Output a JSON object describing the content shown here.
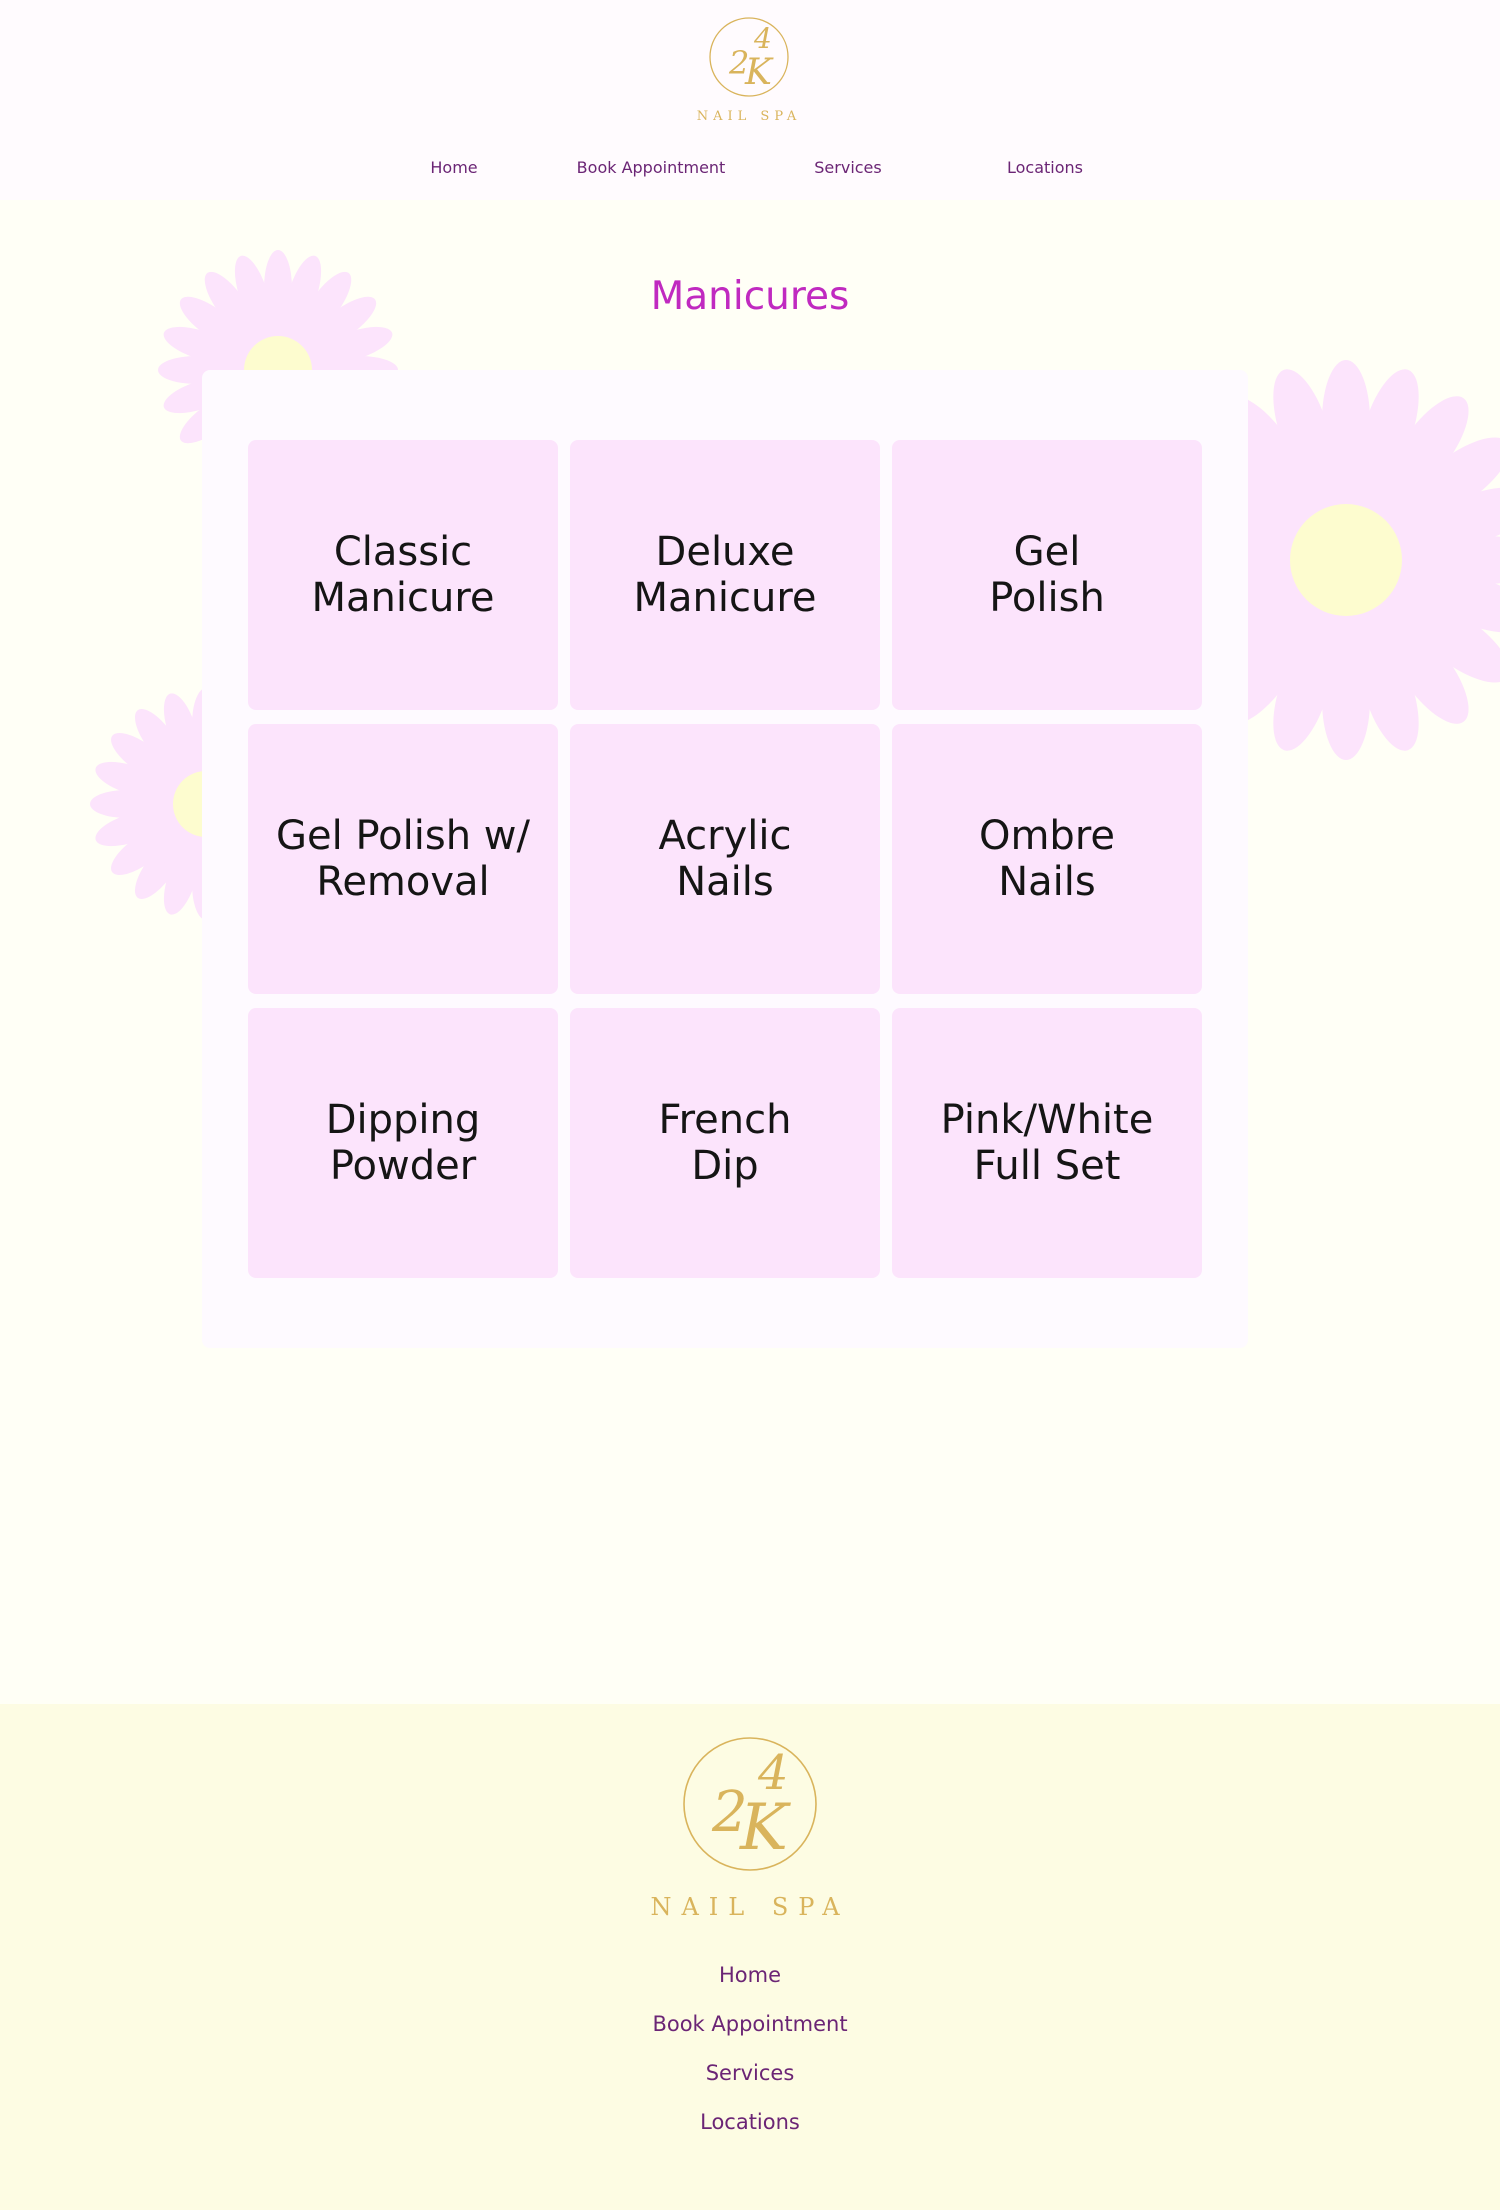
{
  "brand": {
    "monogram_top": "4",
    "monogram_left": "2",
    "monogram_right": "K",
    "name": "NAIL SPA",
    "gold_color": "#d9b45c"
  },
  "nav": {
    "items": [
      "Home",
      "Book Appointment",
      "Services",
      "Locations"
    ]
  },
  "main": {
    "title": "Manicures",
    "services": [
      {
        "line1": "Classic",
        "line2": "Manicure"
      },
      {
        "line1": "Deluxe",
        "line2": "Manicure"
      },
      {
        "line1": "Gel",
        "line2": "Polish"
      },
      {
        "line1": "Gel Polish w/",
        "line2": "Removal"
      },
      {
        "line1": "Acrylic",
        "line2": "Nails"
      },
      {
        "line1": "Ombre",
        "line2": "Nails"
      },
      {
        "line1": "Dipping",
        "line2": "Powder"
      },
      {
        "line1": "French",
        "line2": "Dip"
      },
      {
        "line1": "Pink/White",
        "line2": "Full Set"
      }
    ]
  },
  "footer": {
    "links": [
      "Home",
      "Book Appointment",
      "Services",
      "Locations"
    ]
  },
  "colors": {
    "accent_title": "#c02ac0",
    "nav_text": "#6b2575",
    "tile_bg": "#fce4fc",
    "page_bg": "#fffff6",
    "footer_bg": "#fdfce3",
    "flower_petal": "#fce4fc",
    "flower_center": "#fdfccf"
  }
}
